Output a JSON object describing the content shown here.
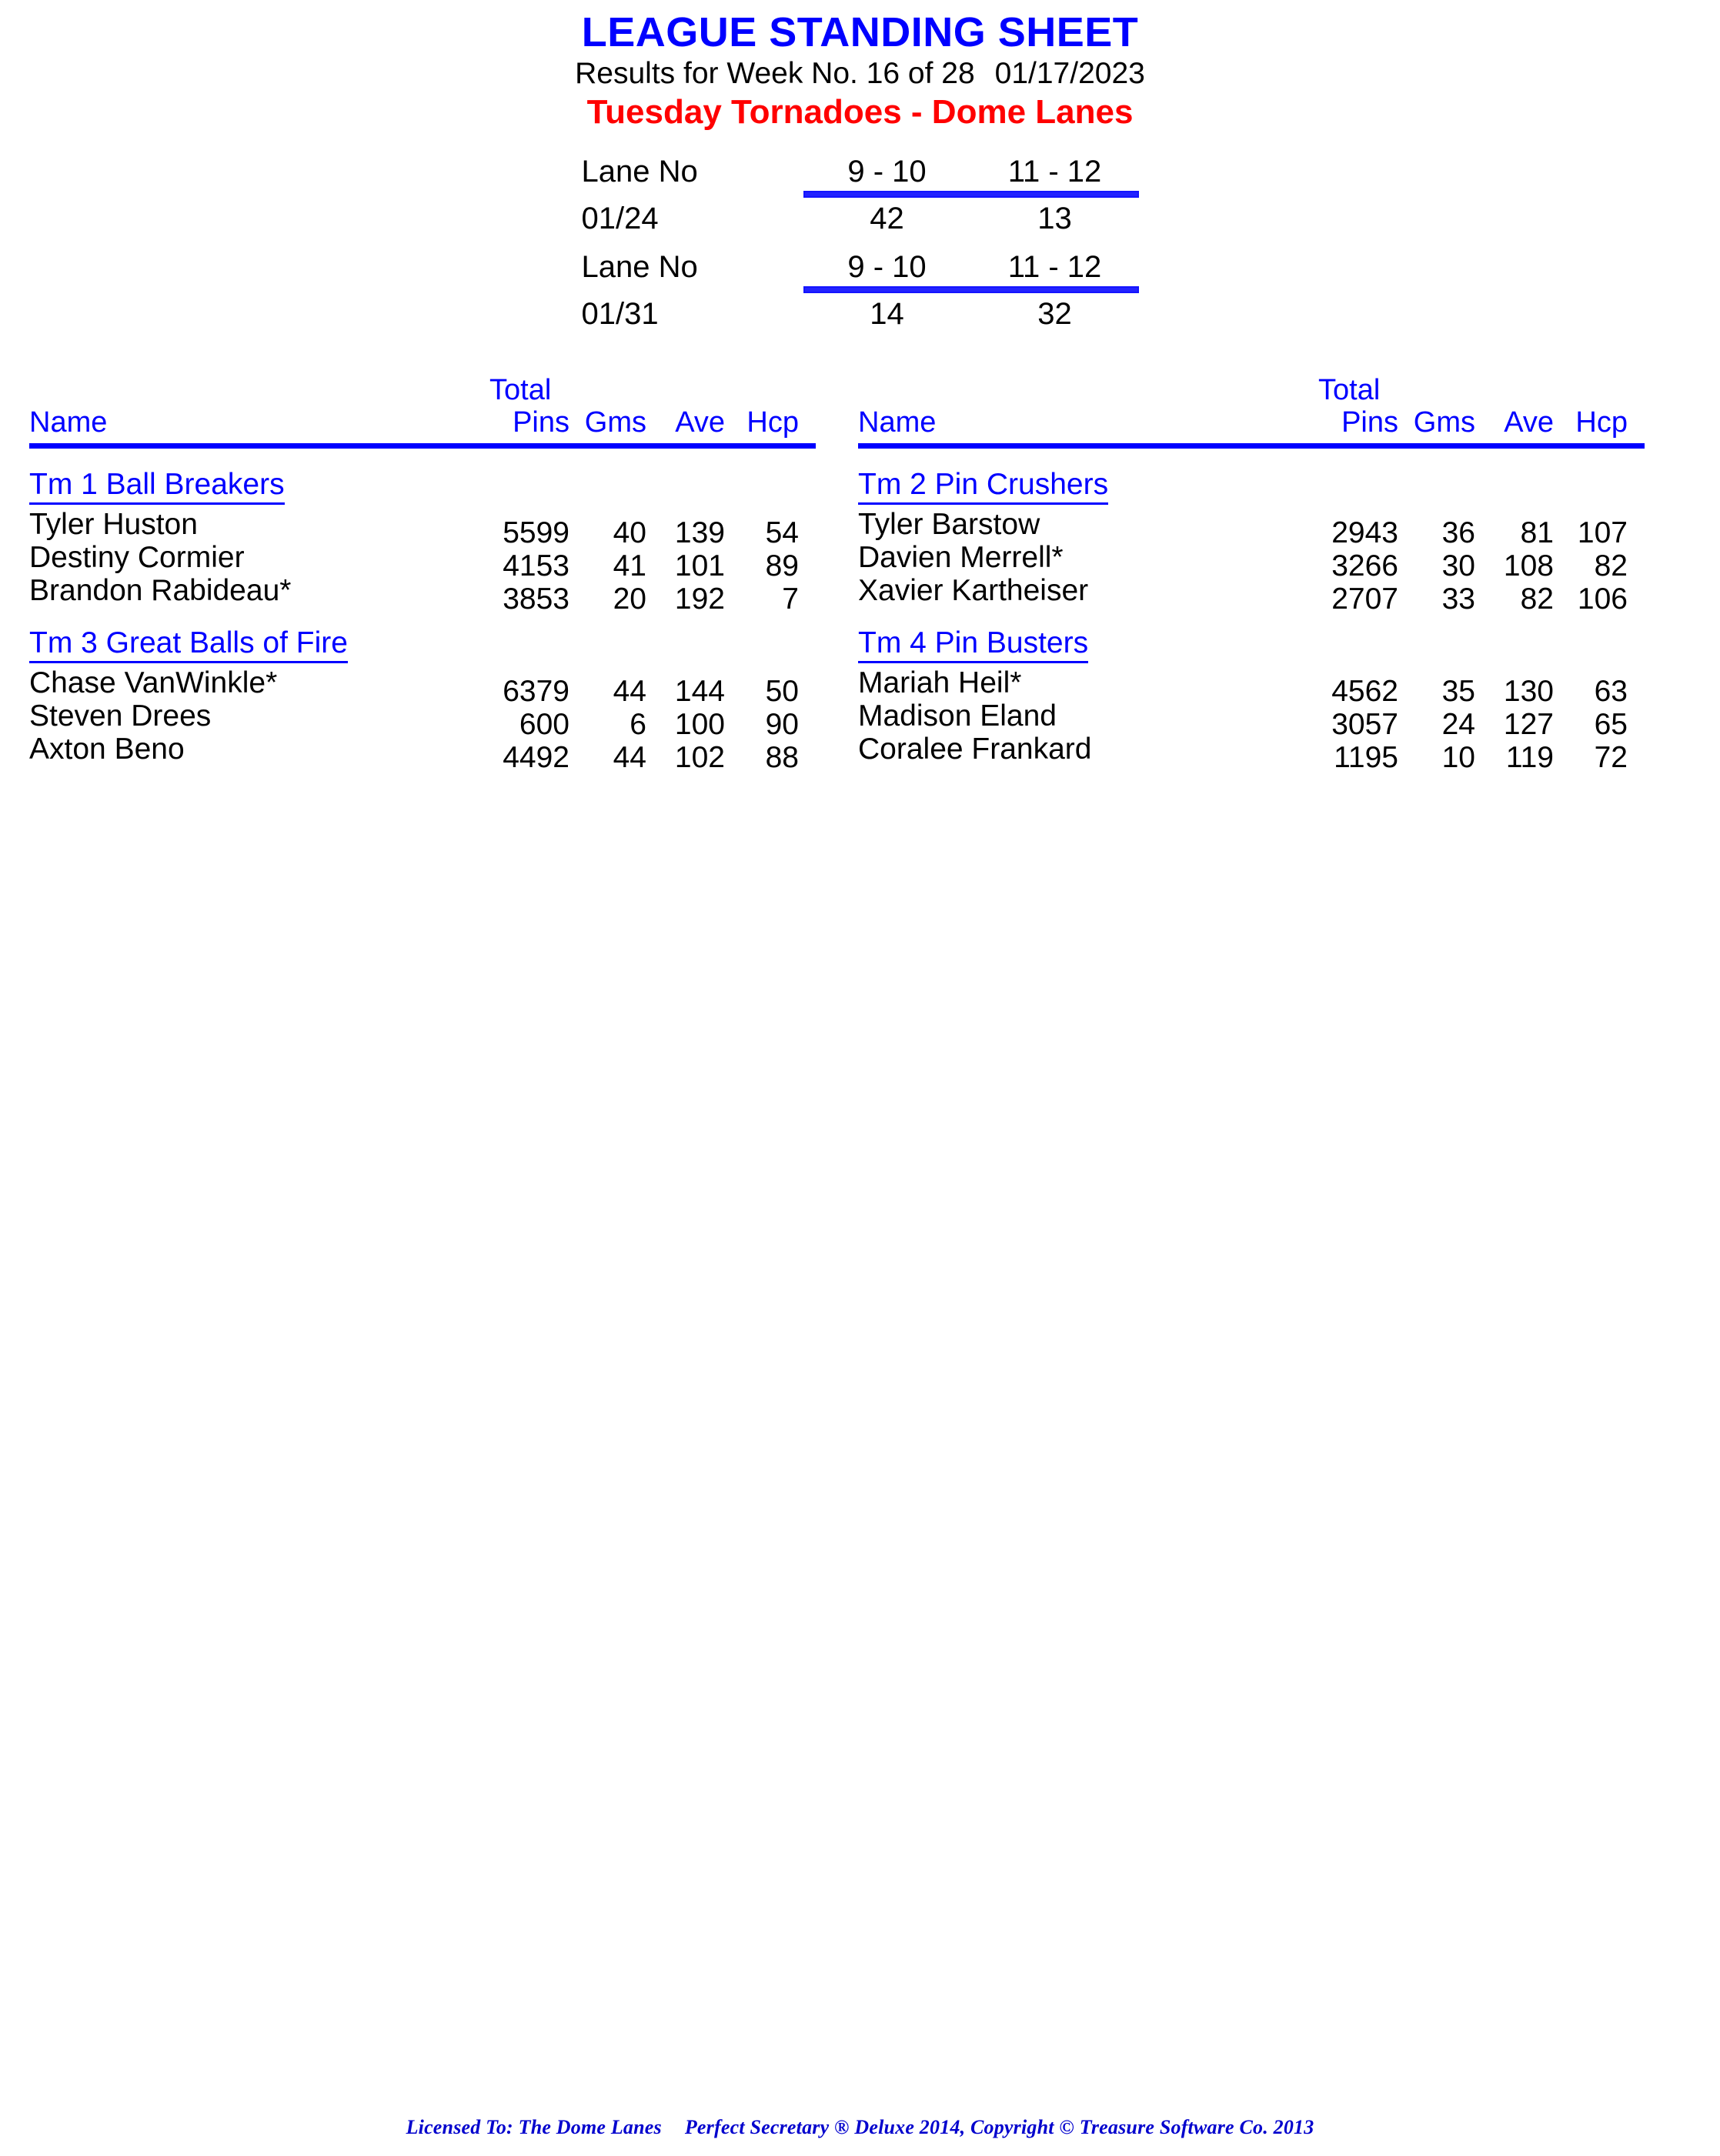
{
  "header": {
    "title": "LEAGUE STANDING SHEET",
    "results_label": "Results for Week No. 16 of 28",
    "date": "01/17/2023",
    "league": "Tuesday Tornadoes - Dome Lanes",
    "title_color": "#0000FF",
    "league_color": "#FF0000"
  },
  "lane_schedule": [
    {
      "lane_label": "Lane No",
      "pair_1": "9 - 10",
      "pair_2": "11 - 12",
      "date": "01/24",
      "teams": [
        "4",
        "2",
        "1",
        "3"
      ]
    },
    {
      "lane_label": "Lane No",
      "pair_1": "9 - 10",
      "pair_2": "11 - 12",
      "date": "01/31",
      "teams": [
        "1",
        "4",
        "3",
        "2"
      ]
    }
  ],
  "columns": {
    "name": "Name",
    "total": "Total",
    "pins": "Pins",
    "gms": "Gms",
    "ave": "Ave",
    "hcp": "Hcp"
  },
  "teams": [
    {
      "name": "Tm 1 Ball Breakers",
      "bowlers": [
        {
          "name": "Tyler Huston",
          "pins": "5599",
          "gms": "40",
          "ave": "139",
          "hcp": "54"
        },
        {
          "name": "Destiny Cormier",
          "pins": "4153",
          "gms": "41",
          "ave": "101",
          "hcp": "89"
        },
        {
          "name": "Brandon Rabideau*",
          "pins": "3853",
          "gms": "20",
          "ave": "192",
          "hcp": "7"
        }
      ]
    },
    {
      "name": "Tm 2 Pin Crushers",
      "bowlers": [
        {
          "name": "Tyler Barstow",
          "pins": "2943",
          "gms": "36",
          "ave": "81",
          "hcp": "107"
        },
        {
          "name": "Davien Merrell*",
          "pins": "3266",
          "gms": "30",
          "ave": "108",
          "hcp": "82"
        },
        {
          "name": "Xavier Kartheiser",
          "pins": "2707",
          "gms": "33",
          "ave": "82",
          "hcp": "106"
        }
      ]
    },
    {
      "name": "Tm 3 Great Balls of Fire",
      "bowlers": [
        {
          "name": "Chase VanWinkle*",
          "pins": "6379",
          "gms": "44",
          "ave": "144",
          "hcp": "50"
        },
        {
          "name": "Steven Drees",
          "pins": "600",
          "gms": "6",
          "ave": "100",
          "hcp": "90"
        },
        {
          "name": "Axton Beno",
          "pins": "4492",
          "gms": "44",
          "ave": "102",
          "hcp": "88"
        }
      ]
    },
    {
      "name": "Tm 4 Pin Busters",
      "bowlers": [
        {
          "name": "Mariah Heil*",
          "pins": "4562",
          "gms": "35",
          "ave": "130",
          "hcp": "63"
        },
        {
          "name": "Madison Eland",
          "pins": "3057",
          "gms": "24",
          "ave": "127",
          "hcp": "65"
        },
        {
          "name": "Coralee Frankard",
          "pins": "1195",
          "gms": "10",
          "ave": "119",
          "hcp": "72"
        }
      ]
    }
  ],
  "footer": {
    "licensed_to": "Licensed To: The Dome Lanes",
    "software": "Perfect Secretary ® Deluxe  2014, Copyright © Treasure Software Co. 2013"
  }
}
